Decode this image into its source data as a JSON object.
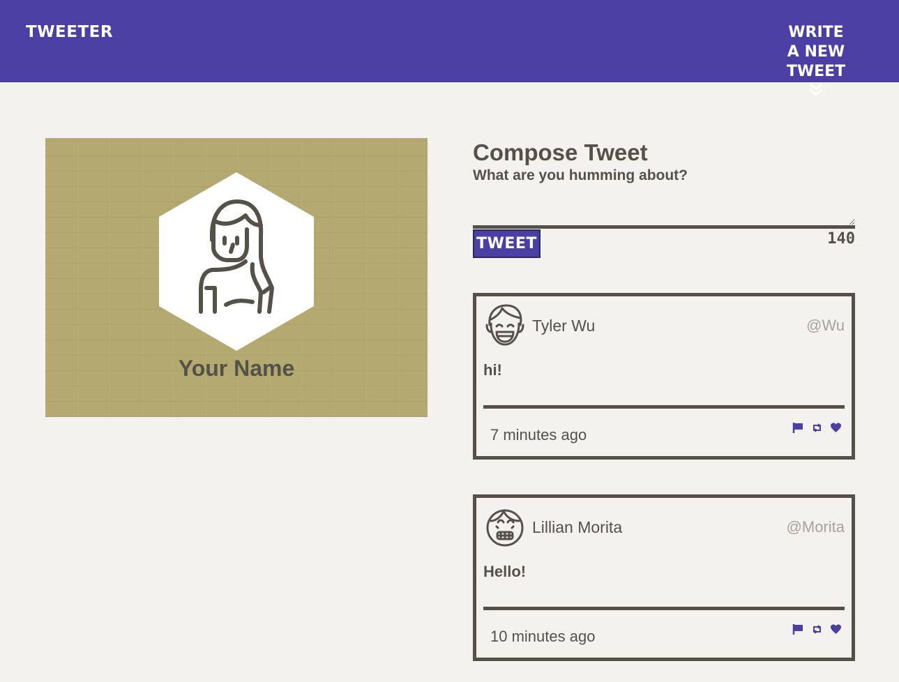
{
  "nav": {
    "brand": "TWEETER",
    "write_line1": "WRITE",
    "write_line2": "A NEW TWEET",
    "chevron_icon": "double-chevron-down-icon"
  },
  "profile": {
    "name": "Your Name",
    "avatar_icon": "woman-avatar-icon"
  },
  "compose": {
    "title": "Compose Tweet",
    "subtitle": "What are you humming about?",
    "textarea_value": "",
    "button_label": "TWEET",
    "counter": "140"
  },
  "tweets": [
    {
      "name": "Tyler Wu",
      "handle": "@Wu",
      "content": "hi!",
      "time": "7 minutes ago",
      "avatar_icon": "laughing-face-avatar-icon"
    },
    {
      "name": "Lillian Morita",
      "handle": "@Morita",
      "content": "Hello!",
      "time": "10 minutes ago",
      "avatar_icon": "grinning-face-avatar-icon"
    }
  ],
  "colors": {
    "accent": "#4c3fa3",
    "text": "#545149",
    "background": "#f4f2ee",
    "profile_bg": "#b4a970"
  }
}
